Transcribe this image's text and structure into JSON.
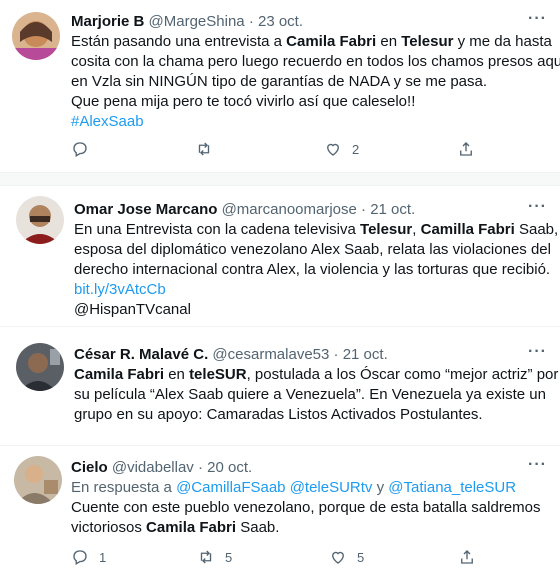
{
  "tweets": [
    {
      "name": "Marjorie B",
      "handle": "@MargeShina",
      "dot": "·",
      "date": "23 oct.",
      "more": "···",
      "lines": {
        "l1_a": "Están pasando una entrevista a ",
        "l1_b": "Camila Fabri",
        "l1_c": " en ",
        "l1_d": "Telesur",
        "l1_e": " y me da hasta",
        "l2": "cosita con la chama pero luego recuerdo en todos los chamos presos aquí",
        "l3": "en Vzla sin NINGÚN tipo de garantías de NADA y se me pasa.",
        "l4": "Que pena mija pero te tocó vivirlo así que caleselo!!",
        "l5": "#AlexSaab"
      },
      "actions": {
        "reply": "",
        "retweet": "",
        "like": "2"
      }
    },
    {
      "name": "Omar Jose Marcano",
      "handle": "@marcanoomarjose",
      "dot": "·",
      "date": "21 oct.",
      "more": "···",
      "lines": {
        "l1_a": "En una Entrevista con la cadena televisiva ",
        "l1_b": "Telesur",
        "l1_c": ", ",
        "l1_d": "Camilla Fabri",
        "l1_e": " Saab,",
        "l2": "esposa del diplomático venezolano Alex Saab, relata las violaciones del",
        "l3": "derecho internacional contra Alex, la violencia y las torturas que recibió.",
        "l4": "bit.ly/3vAtcCb",
        "l5": "@HispanTVcanal"
      }
    },
    {
      "name": "César R. Malavé C.",
      "handle": "@cesarmalave53",
      "dot": "·",
      "date": "21 oct.",
      "more": "···",
      "lines": {
        "l1_a": "Camila Fabri",
        "l1_b": " en ",
        "l1_c": "teleSUR",
        "l1_d": ", postulada a los Óscar como “mejor actriz” por",
        "l2": "su película “Alex Saab quiere a Venezuela”. En Venezuela ya existe un",
        "l3": "grupo en su apoyo: Camaradas Listos Activados Postulantes."
      }
    },
    {
      "name": "Cielo",
      "handle": "@vidabellav",
      "dot": "·",
      "date": "20 oct.",
      "more": "···",
      "lines": {
        "reply_prefix": "En respuesta a ",
        "mention1": "@CamillaFSaab",
        "mention2": "@teleSURtv",
        "y": " y ",
        "mention3": "@Tatiana_teleSUR",
        "l2": "Cuente con este pueblo venezolano, porque de esta batalla saldremos",
        "l3_a": "victoriosos ",
        "l3_b": "Camila Fabri",
        "l3_c": " Saab."
      },
      "actions": {
        "reply": "1",
        "retweet": "5",
        "like": "5"
      }
    }
  ],
  "colors": {
    "link": "#1d9bf0",
    "secondary": "#536471",
    "text": "#0f1419"
  }
}
